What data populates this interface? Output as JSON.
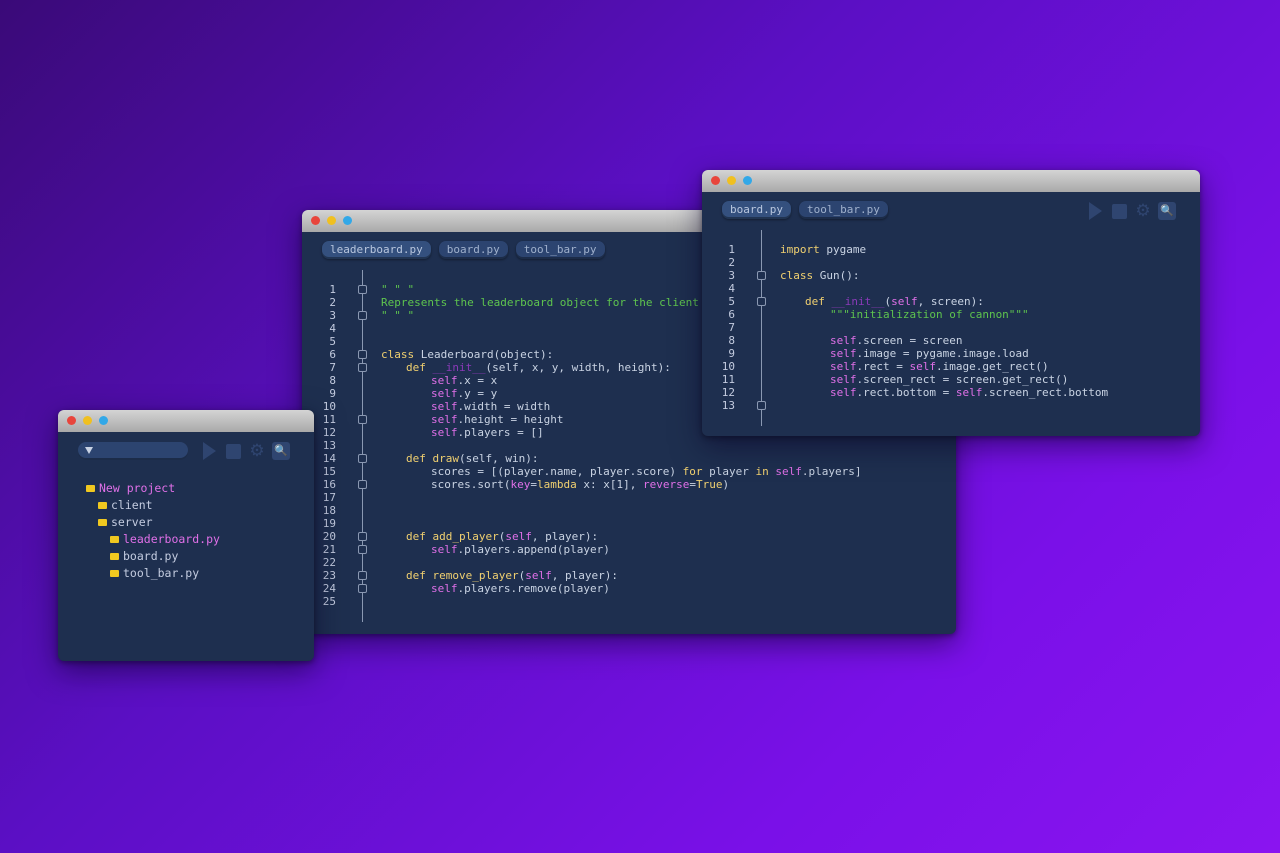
{
  "main_window": {
    "tabs": [
      {
        "label": "leaderboard.py",
        "active": true
      },
      {
        "label": "board.py",
        "active": false
      },
      {
        "label": "tool_bar.py",
        "active": false
      }
    ],
    "lines": [
      {
        "n": "1",
        "fold": true,
        "indent": 0,
        "tokens": [
          {
            "t": "\" \" \"",
            "c": "s"
          }
        ]
      },
      {
        "n": "2",
        "fold": false,
        "indent": 0,
        "tokens": [
          {
            "t": "Represents the leaderboard object for the client",
            "c": "s"
          }
        ]
      },
      {
        "n": "3",
        "fold": true,
        "indent": 0,
        "tokens": [
          {
            "t": "\" \" \"",
            "c": "s"
          }
        ]
      },
      {
        "n": "4",
        "fold": false,
        "indent": 0,
        "tokens": []
      },
      {
        "n": "5",
        "fold": false,
        "indent": 0,
        "tokens": []
      },
      {
        "n": "6",
        "fold": true,
        "indent": 0,
        "tokens": [
          {
            "t": "class",
            "c": "f"
          },
          {
            "t": " Leaderboard(object):",
            "c": "n"
          }
        ]
      },
      {
        "n": "7",
        "fold": true,
        "indent": 1,
        "tokens": [
          {
            "t": "def",
            "c": "f"
          },
          {
            "t": " __init__",
            "c": "d"
          },
          {
            "t": "(self, x, y, width, height):",
            "c": "n"
          }
        ]
      },
      {
        "n": "8",
        "fold": false,
        "indent": 2,
        "tokens": [
          {
            "t": "self",
            "c": "k"
          },
          {
            "t": ".x = x",
            "c": "n"
          }
        ]
      },
      {
        "n": "9",
        "fold": false,
        "indent": 2,
        "tokens": [
          {
            "t": "self",
            "c": "k"
          },
          {
            "t": ".y = y",
            "c": "n"
          }
        ]
      },
      {
        "n": "10",
        "fold": false,
        "indent": 2,
        "tokens": [
          {
            "t": "self",
            "c": "k"
          },
          {
            "t": ".width = width",
            "c": "n"
          }
        ]
      },
      {
        "n": "11",
        "fold": true,
        "indent": 2,
        "tokens": [
          {
            "t": "self",
            "c": "k"
          },
          {
            "t": ".height = height",
            "c": "n"
          }
        ]
      },
      {
        "n": "12",
        "fold": false,
        "indent": 2,
        "tokens": [
          {
            "t": "self",
            "c": "k"
          },
          {
            "t": ".players = []",
            "c": "n"
          }
        ]
      },
      {
        "n": "13",
        "fold": false,
        "indent": 0,
        "tokens": []
      },
      {
        "n": "14",
        "fold": true,
        "indent": 1,
        "tokens": [
          {
            "t": "def",
            "c": "f"
          },
          {
            "t": " draw",
            "c": "f"
          },
          {
            "t": "(self, win):",
            "c": "n"
          }
        ]
      },
      {
        "n": "15",
        "fold": false,
        "indent": 2,
        "tokens": [
          {
            "t": "scores = [(player.name, player.score) ",
            "c": "n"
          },
          {
            "t": "for",
            "c": "f"
          },
          {
            "t": " player ",
            "c": "n"
          },
          {
            "t": "in",
            "c": "f"
          },
          {
            "t": " ",
            "c": "n"
          },
          {
            "t": "self",
            "c": "k"
          },
          {
            "t": ".players]",
            "c": "n"
          }
        ]
      },
      {
        "n": "16",
        "fold": true,
        "indent": 2,
        "tokens": [
          {
            "t": "scores.sort(",
            "c": "n"
          },
          {
            "t": "key",
            "c": "k"
          },
          {
            "t": "=",
            "c": "n"
          },
          {
            "t": "lambda",
            "c": "f"
          },
          {
            "t": " x: x[1], ",
            "c": "n"
          },
          {
            "t": "reverse",
            "c": "k"
          },
          {
            "t": "=",
            "c": "n"
          },
          {
            "t": "True",
            "c": "f"
          },
          {
            "t": ")",
            "c": "n"
          }
        ]
      },
      {
        "n": "17",
        "fold": false,
        "indent": 0,
        "tokens": []
      },
      {
        "n": "18",
        "fold": false,
        "indent": 0,
        "tokens": []
      },
      {
        "n": "19",
        "fold": false,
        "indent": 0,
        "tokens": []
      },
      {
        "n": "20",
        "fold": true,
        "indent": 1,
        "tokens": [
          {
            "t": "def",
            "c": "f"
          },
          {
            "t": " add_player",
            "c": "f"
          },
          {
            "t": "(",
            "c": "n"
          },
          {
            "t": "self",
            "c": "k"
          },
          {
            "t": ", player):",
            "c": "n"
          }
        ]
      },
      {
        "n": "21",
        "fold": true,
        "indent": 2,
        "tokens": [
          {
            "t": "self",
            "c": "k"
          },
          {
            "t": ".players.append(player)",
            "c": "n"
          }
        ]
      },
      {
        "n": "22",
        "fold": false,
        "indent": 0,
        "tokens": []
      },
      {
        "n": "23",
        "fold": true,
        "indent": 1,
        "tokens": [
          {
            "t": "def",
            "c": "f"
          },
          {
            "t": " remove_player",
            "c": "f"
          },
          {
            "t": "(",
            "c": "n"
          },
          {
            "t": "self",
            "c": "k"
          },
          {
            "t": ", player):",
            "c": "n"
          }
        ]
      },
      {
        "n": "24",
        "fold": true,
        "indent": 2,
        "tokens": [
          {
            "t": "self",
            "c": "k"
          },
          {
            "t": ".players.remove(player)",
            "c": "n"
          }
        ]
      },
      {
        "n": "25",
        "fold": false,
        "indent": 0,
        "tokens": []
      }
    ]
  },
  "right_window": {
    "tabs": [
      {
        "label": "board.py",
        "active": true
      },
      {
        "label": "tool_bar.py",
        "active": false
      }
    ],
    "toolbar": {
      "icons": [
        "play-icon",
        "stop-icon",
        "gear-icon",
        "search-icon"
      ]
    },
    "lines": [
      {
        "n": "1",
        "fold": false,
        "indent": 0,
        "tokens": [
          {
            "t": "import",
            "c": "f"
          },
          {
            "t": " pygame",
            "c": "n"
          }
        ]
      },
      {
        "n": "2",
        "fold": false,
        "indent": 0,
        "tokens": []
      },
      {
        "n": "3",
        "fold": true,
        "indent": 0,
        "tokens": [
          {
            "t": "class",
            "c": "f"
          },
          {
            "t": " Gun():",
            "c": "n"
          }
        ]
      },
      {
        "n": "4",
        "fold": false,
        "indent": 0,
        "tokens": []
      },
      {
        "n": "5",
        "fold": true,
        "indent": 1,
        "tokens": [
          {
            "t": "def",
            "c": "f"
          },
          {
            "t": " __init__",
            "c": "d"
          },
          {
            "t": "(",
            "c": "n"
          },
          {
            "t": "self",
            "c": "k"
          },
          {
            "t": ", screen):",
            "c": "n"
          }
        ]
      },
      {
        "n": "6",
        "fold": false,
        "indent": 2,
        "tokens": [
          {
            "t": "\"\"\"initialization of cannon\"\"\"",
            "c": "s"
          }
        ]
      },
      {
        "n": "7",
        "fold": false,
        "indent": 0,
        "tokens": []
      },
      {
        "n": "8",
        "fold": false,
        "indent": 2,
        "tokens": [
          {
            "t": "self",
            "c": "k"
          },
          {
            "t": ".screen = screen",
            "c": "n"
          }
        ]
      },
      {
        "n": "9",
        "fold": false,
        "indent": 2,
        "tokens": [
          {
            "t": "self",
            "c": "k"
          },
          {
            "t": ".image = pygame.image.load",
            "c": "n"
          }
        ]
      },
      {
        "n": "10",
        "fold": false,
        "indent": 2,
        "tokens": [
          {
            "t": "self",
            "c": "k"
          },
          {
            "t": ".rect = ",
            "c": "n"
          },
          {
            "t": "self",
            "c": "k"
          },
          {
            "t": ".image.get_rect()",
            "c": "n"
          }
        ]
      },
      {
        "n": "11",
        "fold": false,
        "indent": 2,
        "tokens": [
          {
            "t": "self",
            "c": "k"
          },
          {
            "t": ".screen_rect = screen.get_rect()",
            "c": "n"
          }
        ]
      },
      {
        "n": "12",
        "fold": false,
        "indent": 2,
        "tokens": [
          {
            "t": "self",
            "c": "k"
          },
          {
            "t": ".rect.bottom = ",
            "c": "n"
          },
          {
            "t": "self",
            "c": "k"
          },
          {
            "t": ".screen_rect.bottom",
            "c": "n"
          }
        ]
      },
      {
        "n": "13",
        "fold": true,
        "indent": 0,
        "tokens": []
      }
    ]
  },
  "project_window": {
    "toolbar": {
      "icons": [
        "play-icon",
        "stop-icon",
        "gear-icon",
        "search-icon"
      ]
    },
    "tree": [
      {
        "label": "New project",
        "level": 0,
        "highlight": "pink"
      },
      {
        "label": "client",
        "level": 1,
        "highlight": "none"
      },
      {
        "label": "server",
        "level": 1,
        "highlight": "none"
      },
      {
        "label": "leaderboard.py",
        "level": 2,
        "highlight": "pink"
      },
      {
        "label": "board.py",
        "level": 2,
        "highlight": "none"
      },
      {
        "label": "tool_bar.py",
        "level": 2,
        "highlight": "none"
      }
    ]
  },
  "colors": {
    "editor_bg": "#1e2f4f",
    "keyword": "#f0d070",
    "self": "#e070e8",
    "string": "#5ec44e",
    "tree_highlight": "#e070e8"
  }
}
